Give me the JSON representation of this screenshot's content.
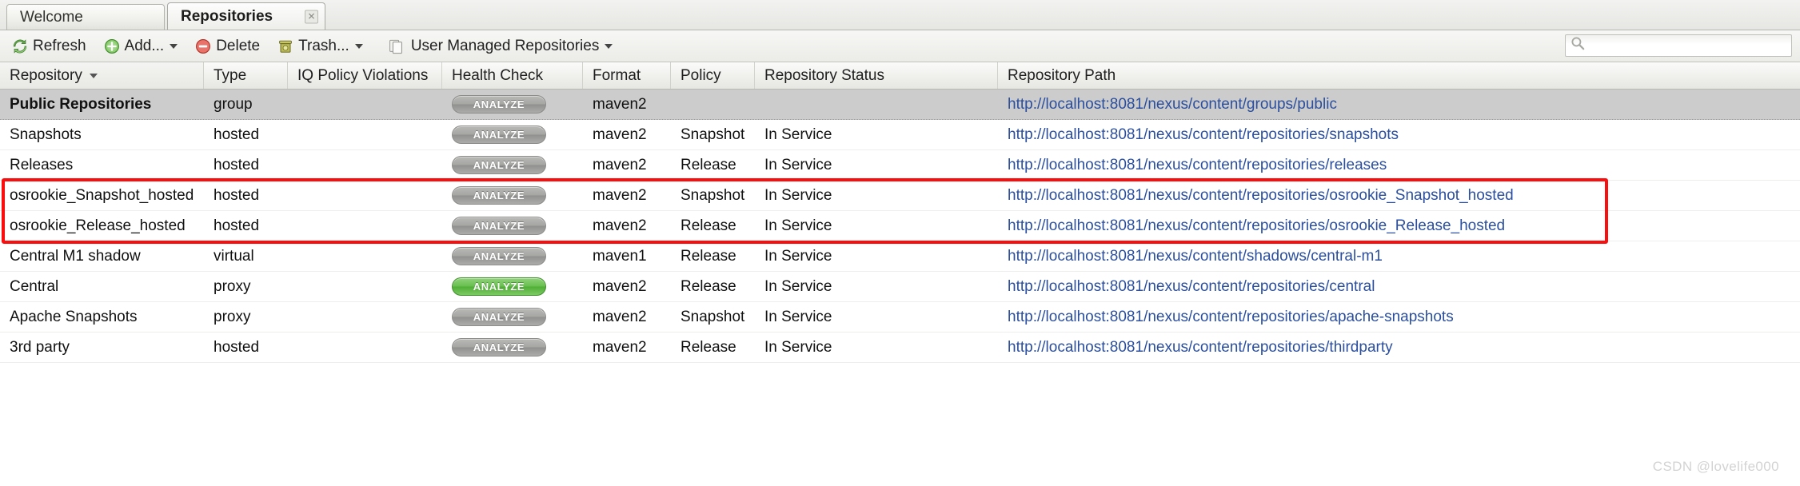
{
  "window": {
    "tabs": [
      {
        "label": "Welcome",
        "active": false,
        "closable": false
      },
      {
        "label": "Repositories",
        "active": true,
        "closable": true,
        "close_icon": "close-icon"
      }
    ]
  },
  "toolbar": {
    "refresh_label": "Refresh",
    "refresh_icon": "refresh-icon",
    "add_label": "Add...",
    "add_icon": "add-circle-icon",
    "delete_label": "Delete",
    "delete_icon": "delete-circle-icon",
    "trash_label": "Trash...",
    "trash_icon": "trash-can-icon",
    "user_managed_label": "User Managed Repositories",
    "user_managed_icon": "copy-pages-icon",
    "search": {
      "icon": "search-icon",
      "value": "",
      "placeholder": ""
    }
  },
  "grid": {
    "columns": [
      {
        "key": "repository",
        "label": "Repository",
        "sorted": true,
        "sort_icon": "chevron-down-icon"
      },
      {
        "key": "type",
        "label": "Type",
        "sorted": false
      },
      {
        "key": "iq_policy_violations",
        "label": "IQ Policy Violations",
        "sorted": false
      },
      {
        "key": "health_check",
        "label": "Health Check",
        "sorted": false
      },
      {
        "key": "format",
        "label": "Format",
        "sorted": false
      },
      {
        "key": "policy",
        "label": "Policy",
        "sorted": false
      },
      {
        "key": "repository_status",
        "label": "Repository Status",
        "sorted": false
      },
      {
        "key": "repository_path",
        "label": "Repository Path",
        "sorted": false
      }
    ],
    "analyze_label": "ANALYZE",
    "rows": [
      {
        "repository": "Public Repositories",
        "type": "group",
        "iq_policy_violations": "",
        "health_check": "ANALYZE",
        "health_check_state": "grey",
        "format": "maven2",
        "policy": "",
        "repository_status": "",
        "repository_path": "http://localhost:8081/nexus/content/groups/public",
        "selected": true,
        "bold": true,
        "highlighted": false
      },
      {
        "repository": "Snapshots",
        "type": "hosted",
        "iq_policy_violations": "",
        "health_check": "ANALYZE",
        "health_check_state": "grey",
        "format": "maven2",
        "policy": "Snapshot",
        "repository_status": "In Service",
        "repository_path": "http://localhost:8081/nexus/content/repositories/snapshots",
        "selected": false,
        "bold": false,
        "highlighted": false
      },
      {
        "repository": "Releases",
        "type": "hosted",
        "iq_policy_violations": "",
        "health_check": "ANALYZE",
        "health_check_state": "grey",
        "format": "maven2",
        "policy": "Release",
        "repository_status": "In Service",
        "repository_path": "http://localhost:8081/nexus/content/repositories/releases",
        "selected": false,
        "bold": false,
        "highlighted": false
      },
      {
        "repository": "osrookie_Snapshot_hosted",
        "type": "hosted",
        "iq_policy_violations": "",
        "health_check": "ANALYZE",
        "health_check_state": "grey",
        "format": "maven2",
        "policy": "Snapshot",
        "repository_status": "In Service",
        "repository_path": "http://localhost:8081/nexus/content/repositories/osrookie_Snapshot_hosted",
        "selected": false,
        "bold": false,
        "highlighted": true
      },
      {
        "repository": "osrookie_Release_hosted",
        "type": "hosted",
        "iq_policy_violations": "",
        "health_check": "ANALYZE",
        "health_check_state": "grey",
        "format": "maven2",
        "policy": "Release",
        "repository_status": "In Service",
        "repository_path": "http://localhost:8081/nexus/content/repositories/osrookie_Release_hosted",
        "selected": false,
        "bold": false,
        "highlighted": true
      },
      {
        "repository": "Central M1 shadow",
        "type": "virtual",
        "iq_policy_violations": "",
        "health_check": "ANALYZE",
        "health_check_state": "grey",
        "format": "maven1",
        "policy": "Release",
        "repository_status": "In Service",
        "repository_path": "http://localhost:8081/nexus/content/shadows/central-m1",
        "selected": false,
        "bold": false,
        "highlighted": false
      },
      {
        "repository": "Central",
        "type": "proxy",
        "iq_policy_violations": "",
        "health_check": "ANALYZE",
        "health_check_state": "green",
        "format": "maven2",
        "policy": "Release",
        "repository_status": "In Service",
        "repository_path": "http://localhost:8081/nexus/content/repositories/central",
        "selected": false,
        "bold": false,
        "highlighted": false
      },
      {
        "repository": "Apache Snapshots",
        "type": "proxy",
        "iq_policy_violations": "",
        "health_check": "ANALYZE",
        "health_check_state": "grey",
        "format": "maven2",
        "policy": "Snapshot",
        "repository_status": "In Service",
        "repository_path": "http://localhost:8081/nexus/content/repositories/apache-snapshots",
        "selected": false,
        "bold": false,
        "highlighted": false
      },
      {
        "repository": "3rd party",
        "type": "hosted",
        "iq_policy_violations": "",
        "health_check": "ANALYZE",
        "health_check_state": "grey",
        "format": "maven2",
        "policy": "Release",
        "repository_status": "In Service",
        "repository_path": "http://localhost:8081/nexus/content/repositories/thirdparty",
        "selected": false,
        "bold": false,
        "highlighted": false
      }
    ]
  },
  "annotation": {
    "highlight_color": "#fb0d0d"
  },
  "watermark": {
    "text": "CSDN @lovelife000"
  }
}
